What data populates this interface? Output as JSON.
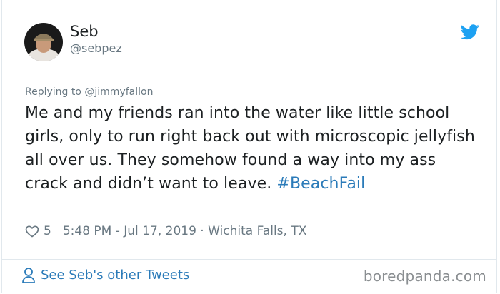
{
  "author": {
    "name": "Seb",
    "handle": "@sebpez"
  },
  "reply": {
    "prefix": "Replying to ",
    "mention": "@jimmyfallon"
  },
  "tweet": {
    "text": "Me and my friends ran into the water like little school girls, only to run right back out with microscopic jellyfish all over us. They somehow found a way into my ass crack and didn’t want to leave. ",
    "hashtag": "#BeachFail"
  },
  "meta": {
    "like_count": "5",
    "timestamp": "5:48 PM - Jul 17, 2019",
    "separator": " · ",
    "location": "Wichita Falls, TX"
  },
  "footer": {
    "see_more": "See Seb's other Tweets",
    "watermark": "boredpanda.com"
  },
  "icons": {
    "brand": "twitter-bird-icon",
    "like": "heart-icon",
    "profile": "person-icon"
  },
  "colors": {
    "twitter_blue": "#1da1f2",
    "link_blue": "#2b7bb9",
    "secondary_text": "#697882",
    "primary_text": "#1c2022"
  }
}
